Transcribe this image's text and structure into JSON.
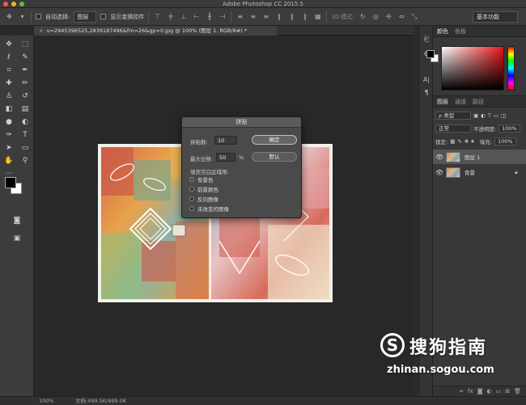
{
  "app": {
    "title": "Adobe Photoshop CC 2015.5",
    "traffic_colors": [
      "#ee5a52",
      "#f2b22e",
      "#5dbe3f"
    ]
  },
  "options_bar": {
    "auto_select_label": "自动选择:",
    "auto_select_value": "图层",
    "show_transform_label": "显示变换控件",
    "mode_3d_label": "3D 模式:",
    "workspace": "基本功能"
  },
  "document": {
    "tab_title": "u=2945396525,2839187496&fm=26&gp=0.jpg @ 100% (图层 1, RGB/8#) *",
    "close_glyph": "×"
  },
  "status": {
    "zoom": "100%",
    "doc_info": "文档:499.5K/999.0K"
  },
  "panels": {
    "color_tabs": [
      "颜色",
      "色板"
    ],
    "layer_tabs": [
      "图层",
      "通道",
      "路径"
    ],
    "filter_kind": "ρ 类型",
    "blend_mode": "正常",
    "opacity_label": "不透明度:",
    "opacity_value": "100%",
    "lock_label": "锁定:",
    "fill_label": "填充:",
    "fill_value": "100%",
    "layers": [
      {
        "name": "图层 1",
        "selected": true,
        "locked": false
      },
      {
        "name": "背景",
        "selected": false,
        "locked": true
      }
    ]
  },
  "dialog": {
    "title": "拼贴",
    "tiles_label": "拼贴数:",
    "tiles_value": "10",
    "offset_label": "最大位移:",
    "offset_value": "50",
    "offset_unit": "%",
    "ok_label": "确定",
    "default_label": "默认",
    "fill_group_label": "填充空白区域用:",
    "options": [
      {
        "label": "背景色",
        "selected": true
      },
      {
        "label": "前景颜色",
        "selected": false
      },
      {
        "label": "反向图像",
        "selected": false
      },
      {
        "label": "未改变的图像",
        "selected": false
      }
    ]
  },
  "watermark": {
    "logo_letter": "S",
    "brand": "搜狗指南",
    "url": "zhinan.sogou.com"
  }
}
